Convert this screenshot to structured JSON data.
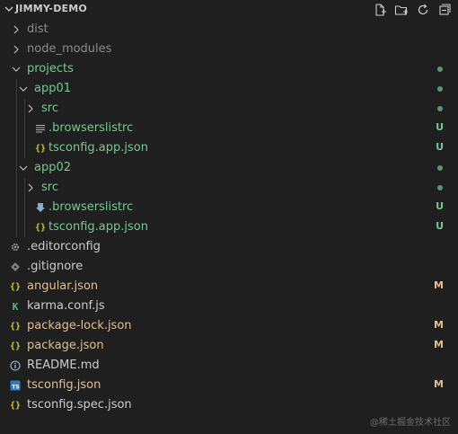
{
  "explorer": {
    "title": "JIMMY-DEMO",
    "actions": [
      {
        "name": "new-file-icon"
      },
      {
        "name": "new-folder-icon"
      },
      {
        "name": "refresh-icon"
      },
      {
        "name": "collapse-all-icon"
      }
    ]
  },
  "colors": {
    "background": "#1f1f1f",
    "dim": "#8b8b8b",
    "green": "#73c991",
    "yellow": "#e2c08d",
    "white": "#cccccc",
    "json_icon": "#cbcb41",
    "karma_icon": "#5fb878",
    "ts_icon": "#3178c6",
    "info_icon": "#9fb8d4"
  },
  "tree": [
    {
      "label": "dist",
      "kind": "folder",
      "expanded": false,
      "depth": 0,
      "color": "dim",
      "status": ""
    },
    {
      "label": "node_modules",
      "kind": "folder",
      "expanded": false,
      "depth": 0,
      "color": "dim",
      "status": ""
    },
    {
      "label": "projects",
      "kind": "folder",
      "expanded": true,
      "depth": 0,
      "color": "green",
      "status": "dot"
    },
    {
      "label": "app01",
      "kind": "folder",
      "expanded": true,
      "depth": 1,
      "color": "green",
      "status": "dot"
    },
    {
      "label": "src",
      "kind": "folder",
      "expanded": false,
      "depth": 2,
      "color": "green",
      "status": "dot"
    },
    {
      "label": ".browserslistrc",
      "kind": "file",
      "icon": "lines-icon",
      "depth": 2,
      "color": "green",
      "status": "U"
    },
    {
      "label": "tsconfig.app.json",
      "kind": "file",
      "icon": "json-icon",
      "depth": 2,
      "color": "green",
      "status": "U"
    },
    {
      "label": "app02",
      "kind": "folder",
      "expanded": true,
      "depth": 1,
      "color": "green",
      "status": "dot"
    },
    {
      "label": "src",
      "kind": "folder",
      "expanded": false,
      "depth": 2,
      "color": "green",
      "status": "dot"
    },
    {
      "label": ".browserslistrc",
      "kind": "file",
      "icon": "browserslist-icon",
      "depth": 2,
      "color": "green",
      "status": "U"
    },
    {
      "label": "tsconfig.app.json",
      "kind": "file",
      "icon": "json-icon",
      "depth": 2,
      "color": "green",
      "status": "U"
    },
    {
      "label": ".editorconfig",
      "kind": "file",
      "icon": "gear-icon",
      "depth": 0,
      "color": "white",
      "status": ""
    },
    {
      "label": ".gitignore",
      "kind": "file",
      "icon": "git-icon",
      "depth": 0,
      "color": "white",
      "status": ""
    },
    {
      "label": "angular.json",
      "kind": "file",
      "icon": "json-icon",
      "depth": 0,
      "color": "yellow",
      "status": "M"
    },
    {
      "label": "karma.conf.js",
      "kind": "file",
      "icon": "karma-icon",
      "depth": 0,
      "color": "white",
      "status": ""
    },
    {
      "label": "package-lock.json",
      "kind": "file",
      "icon": "json-icon",
      "depth": 0,
      "color": "yellow",
      "status": "M"
    },
    {
      "label": "package.json",
      "kind": "file",
      "icon": "json-icon",
      "depth": 0,
      "color": "yellow",
      "status": "M"
    },
    {
      "label": "README.md",
      "kind": "file",
      "icon": "info-icon",
      "depth": 0,
      "color": "white",
      "status": ""
    },
    {
      "label": "tsconfig.json",
      "kind": "file",
      "icon": "ts-icon",
      "depth": 0,
      "color": "yellow",
      "status": "M"
    },
    {
      "label": "tsconfig.spec.json",
      "kind": "file",
      "icon": "json-icon",
      "depth": 0,
      "color": "white",
      "status": ""
    }
  ],
  "watermark": "@稀土掘金技术社区"
}
